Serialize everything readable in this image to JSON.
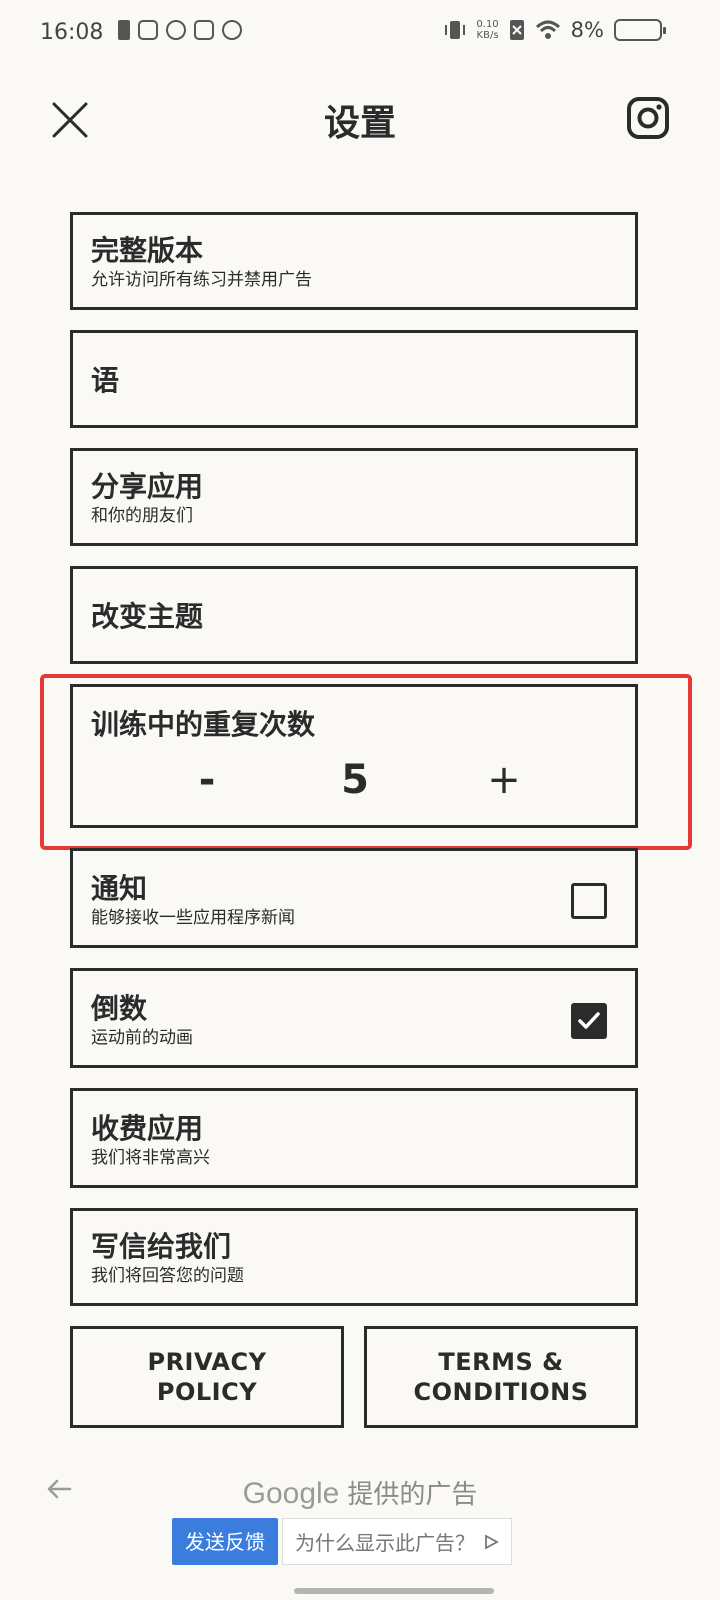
{
  "status_bar": {
    "time": "16:08",
    "net_speed_value": "0.10",
    "net_speed_unit": "KB/s",
    "battery": "8%"
  },
  "header": {
    "title": "设置",
    "close_icon": "close-icon",
    "instagram_icon": "instagram-icon"
  },
  "settings": {
    "full_version": {
      "title": "完整版本",
      "subtitle": "允许访问所有练习并禁用广告"
    },
    "language": {
      "title": "语"
    },
    "share_app": {
      "title": "分享应用",
      "subtitle": "和你的朋友们"
    },
    "change_theme": {
      "title": "改变主题"
    },
    "repetitions": {
      "title": "训练中的重复次数",
      "minus": "-",
      "value": "5",
      "plus": "+"
    },
    "notifications": {
      "title": "通知",
      "subtitle": "能够接收一些应用程序新闻",
      "checked": false
    },
    "countdown": {
      "title": "倒数",
      "subtitle": "运动前的动画",
      "checked": true
    },
    "rate_app": {
      "title": "收费应用",
      "subtitle": "我们将非常高兴"
    },
    "write_us": {
      "title": "写信给我们",
      "subtitle": "我们将回答您的问题"
    }
  },
  "footer": {
    "privacy_line1": "PRIVACY",
    "privacy_line2": "POLICY",
    "terms_line1": "TERMS &",
    "terms_line2": "CONDITIONS"
  },
  "ad": {
    "google": "Google",
    "provided_by": "提供的广告",
    "feedback_button": "发送反馈",
    "why_button": "为什么显示此广告？"
  },
  "colors": {
    "background": "#faf9f6",
    "ink": "#2b2b2b",
    "highlight": "#e53935",
    "ad_button": "#3b7ddd"
  }
}
